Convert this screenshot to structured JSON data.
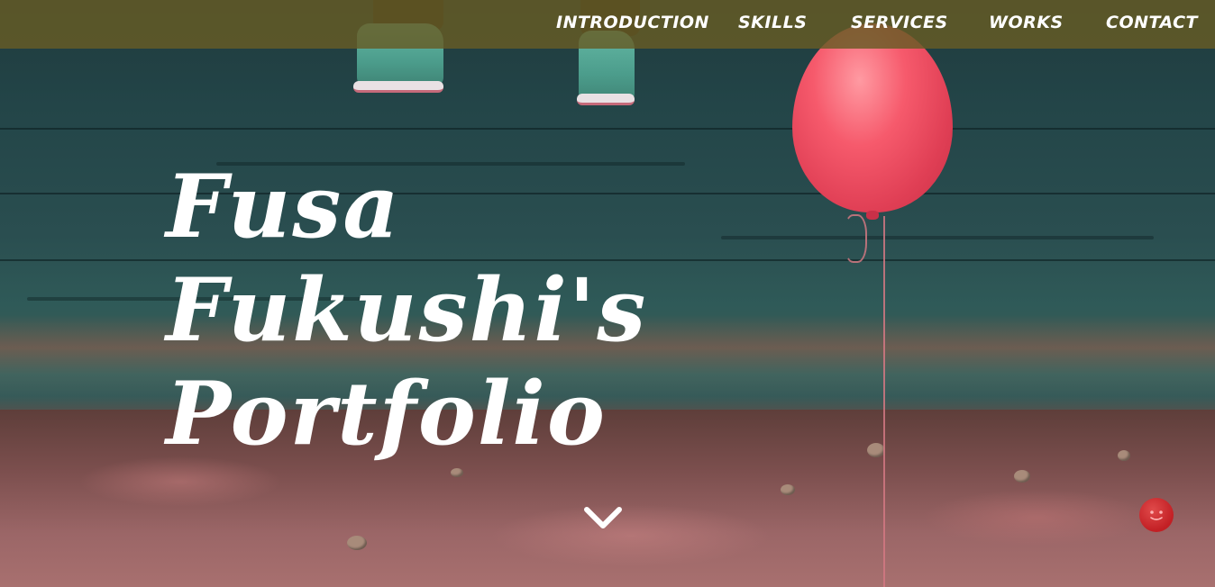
{
  "nav": {
    "items": [
      {
        "label": "INTRODUCTION"
      },
      {
        "label": "SKILLS"
      },
      {
        "label": "SERVICES"
      },
      {
        "label": "WORKS"
      },
      {
        "label": "CONTACT"
      }
    ]
  },
  "hero": {
    "title_line1": "Fusa",
    "title_line2": "Fukushi's",
    "title_line3": "Portfolio"
  },
  "icons": {
    "scroll": "chevron-down-icon",
    "corner": "chat-bubble-icon"
  },
  "colors": {
    "navbar": "#665c24",
    "text": "#ffffff",
    "balloon": "#e03f55",
    "badge": "#c21f24"
  }
}
